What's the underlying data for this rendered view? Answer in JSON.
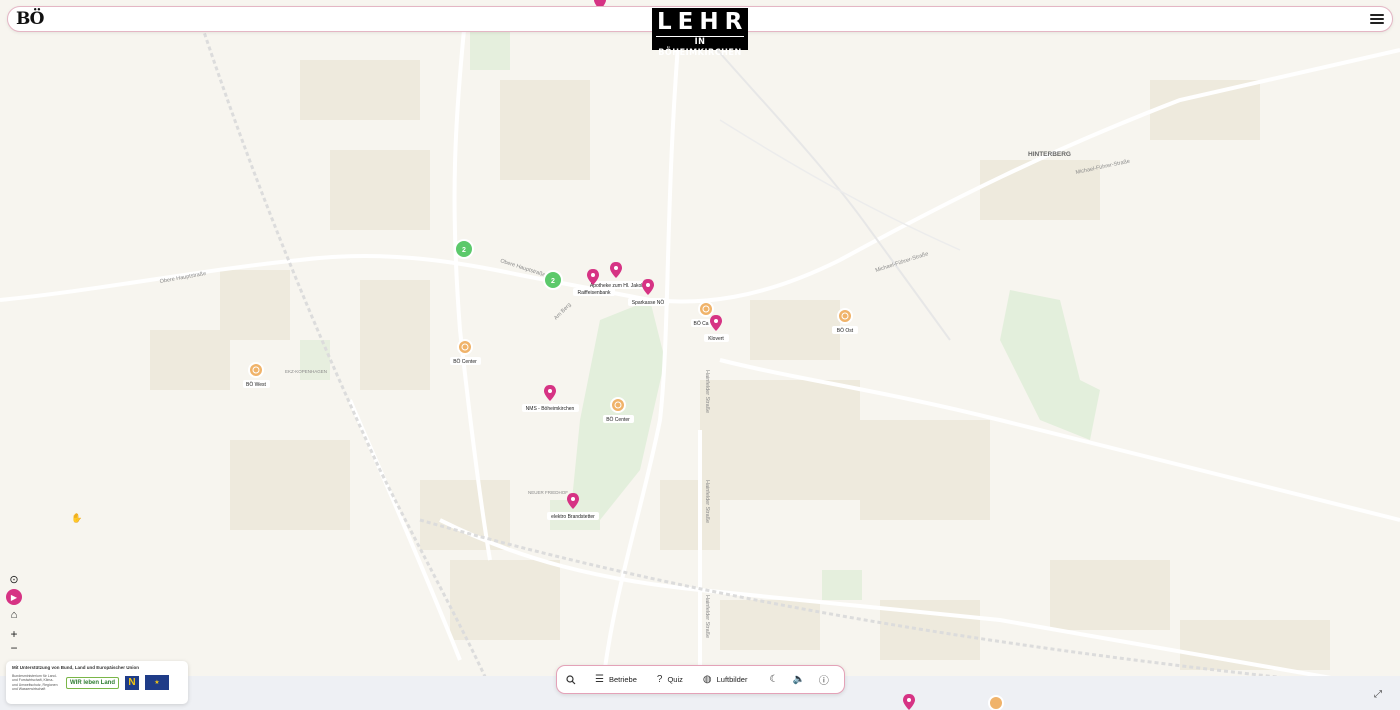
{
  "header": {
    "logo_text": "BÖ",
    "brand_line1": "LEHRE",
    "brand_line2": "IN BÖHEIMKIRCHEN",
    "menu_icon": "hamburger-menu-icon"
  },
  "map": {
    "street_labels": {
      "obere_hauptstrasse_1": "Obere Hauptstraße",
      "obere_hauptstrasse_2": "Obere Hauptstraße",
      "michael_fuehrer_1": "Michael-Führer-Straße",
      "michael_fuehrer_2": "Michael-Führer-Straße",
      "hinterberg": "HINTERBERG",
      "am_berg": "Am Berg",
      "neuer_friedhof": "NEUER FRIEDHOF",
      "hainfelder_1": "Hainfelder Straße",
      "hainfelder_2": "Hainfelder Straße",
      "hainfelder_3": "Hainfelder Straße",
      "ekzkopenhagen": "EKZ-KOPENHAGEN"
    },
    "clusters": [
      {
        "count": "2"
      },
      {
        "count": "2"
      }
    ],
    "places": [
      {
        "label": "Apotheke zum Hl. Jakob",
        "type": "business"
      },
      {
        "label": "Raiffeisenbank",
        "type": "business"
      },
      {
        "label": "Sparkasse NÖ",
        "type": "business"
      },
      {
        "label": "BÖ Ca",
        "type": "center"
      },
      {
        "label": "Klovert",
        "type": "business"
      },
      {
        "label": "BÖ Ost",
        "type": "center"
      },
      {
        "label": "BÖ Center",
        "type": "center"
      },
      {
        "label": "BÖ West",
        "type": "center"
      },
      {
        "label": "NMS - Böheimkirchen",
        "type": "business"
      },
      {
        "label": "BÖ Center",
        "type": "center"
      },
      {
        "label": "elektro Brandstetter",
        "type": "business"
      }
    ],
    "pin_color": "#d63384",
    "center_color": "#f0b36a",
    "cluster_color": "#5cc96b"
  },
  "map_controls": {
    "locate_icon": "locate-icon",
    "play_icon": "play-icon",
    "home_icon": "home-icon",
    "zoom_in": "+",
    "zoom_out": "−"
  },
  "sponsor": {
    "title": "Mit Unterstützung von Bund, Land und Europäischer Union",
    "ministry": "Bundesministerium für Land- und Forstwirtschaft, Klima- und Umweltschutz, Regionen und Wasserwirtschaft",
    "wir_label": "WIR leben Land",
    "n_label": "N",
    "eu_label": "★"
  },
  "toolbar": {
    "search_icon": "search-icon",
    "betriebe_label": "Betriebe",
    "quiz_label": "Quiz",
    "luftbilder_label": "Luftbilder",
    "moon_icon": "moon-icon",
    "sound_icon": "sound-icon",
    "info_icon": "info-icon"
  },
  "colors": {
    "accent": "#d63384",
    "map_background": "#f7f5ef"
  }
}
